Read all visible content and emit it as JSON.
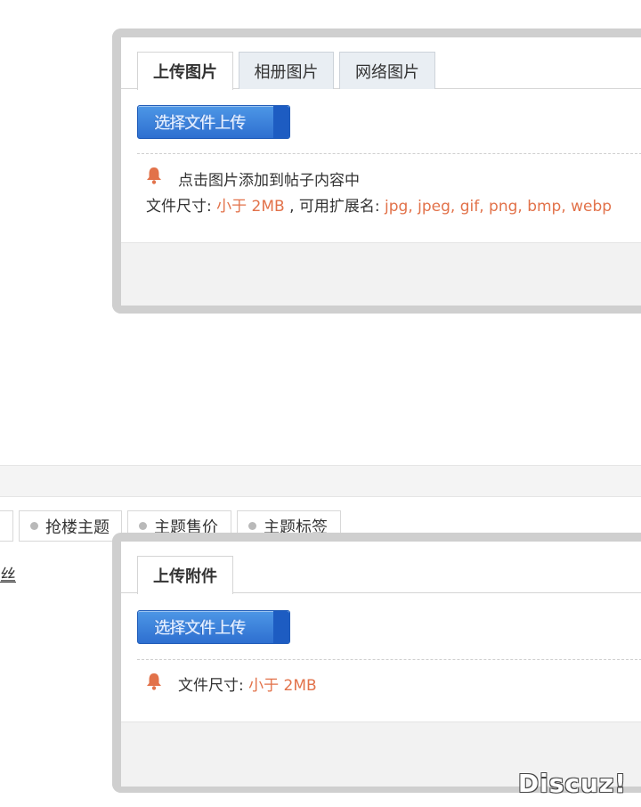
{
  "image_dialog": {
    "tabs": [
      "上传图片",
      "相册图片",
      "网络图片"
    ],
    "upload_button": "选择文件上传",
    "hint": "点击图片添加到帖子内容中",
    "size_label": "文件尺寸: ",
    "size_value": "小于 2MB",
    "ext_label": " , 可用扩展名: ",
    "ext_value": "jpg, jpeg, gif, png, bmp, webp"
  },
  "background_editor": {
    "tabs": [
      "抢楼主题",
      "主题售价",
      "主题标签"
    ],
    "partial_text": "丝"
  },
  "attach_dialog": {
    "tab": "上传附件",
    "upload_button": "选择文件上传",
    "size_label": "文件尺寸: ",
    "size_value": "小于 2MB"
  },
  "watermark": "Discuz!",
  "colors": {
    "accent_orange": "#e2724a",
    "button_blue": "#2e6fd0",
    "dialog_border": "#cfcfcf"
  },
  "icons": {
    "hint": "bell-icon",
    "tab_marker": "dot-icon"
  }
}
